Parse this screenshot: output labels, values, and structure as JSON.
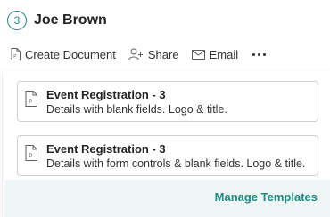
{
  "header": {
    "step_number": "3",
    "name": "Joe Brown"
  },
  "toolbar": {
    "create_document_label": "Create Document",
    "share_label": "Share",
    "email_label": "Email"
  },
  "templates": [
    {
      "title": "Event Registration - 3",
      "description": "Details with blank fields. Logo & title."
    },
    {
      "title": "Event Registration - 3",
      "description": "Details with form controls & blank fields. Logo & title."
    }
  ],
  "footer": {
    "manage_templates_label": "Manage Templates"
  },
  "colors": {
    "accent": "#1e8a80",
    "panel_background": "#eef5f4"
  },
  "icons": {
    "step": "circle-badge",
    "create_document": "document-icon",
    "share": "person-add-icon",
    "email": "envelope-icon",
    "more": "ellipsis-icon",
    "template": "document-icon"
  }
}
